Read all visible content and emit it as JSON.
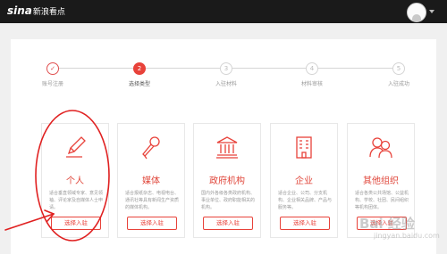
{
  "header": {
    "logo_main": "sina",
    "logo_sub": "新浪看点"
  },
  "steps": [
    {
      "label": "账号注册",
      "state": "done",
      "symbol": "✓"
    },
    {
      "label": "选择类型",
      "state": "active",
      "symbol": "2"
    },
    {
      "label": "入驻材料",
      "state": "todo",
      "symbol": "3"
    },
    {
      "label": "材料审核",
      "state": "todo",
      "symbol": "4"
    },
    {
      "label": "入驻成功",
      "state": "todo",
      "symbol": "5"
    }
  ],
  "cards": [
    {
      "title": "个人",
      "icon": "pencil-icon",
      "desc": "适合垂直领域专家、意见领袖、评论家及自媒体人士申请。",
      "button": "选择入驻"
    },
    {
      "title": "媒体",
      "icon": "microphone-icon",
      "desc": "适合报纸杂志、电视电台、通讯社等具有新闻生产资质的媒体机构。",
      "button": "选择入驻"
    },
    {
      "title": "政府机构",
      "icon": "government-building-icon",
      "desc": "国内外各级各类政府机构、事业单位、政府职能相关的机构。",
      "button": "选择入驻"
    },
    {
      "title": "企业",
      "icon": "office-building-icon",
      "desc": "适合企业、公司、分支机构、企业相关品牌、产品与服务等。",
      "button": "选择入驻"
    },
    {
      "title": "其他组织",
      "icon": "group-icon",
      "desc": "适合各类公共场馆、公益机构、学校、社团、民间组织等机构团体。",
      "button": "选择入驻"
    }
  ],
  "watermark": {
    "line1": "Bai 经验",
    "line2": "jingyan.baidu.com"
  },
  "colors": {
    "accent": "#e8423a",
    "topbar": "#1a1a1a",
    "annotation": "#e02020"
  }
}
